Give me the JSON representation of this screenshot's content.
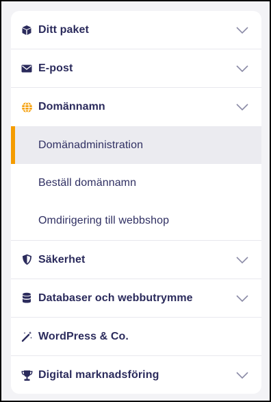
{
  "menu": {
    "accent_color": "#f59c00",
    "text_color": "#2b2b5c",
    "items": [
      {
        "label": "Ditt paket",
        "icon": "box-icon",
        "has_chevron": true
      },
      {
        "label": "E-post",
        "icon": "envelope-icon",
        "has_chevron": true
      },
      {
        "label": "Domännamn",
        "icon": "globe-icon",
        "has_chevron": true,
        "expanded": true,
        "subitems": [
          {
            "label": "Domänadministration",
            "active": true
          },
          {
            "label": "Beställ domännamn",
            "active": false
          },
          {
            "label": "Omdirigering till webbshop",
            "active": false
          }
        ]
      },
      {
        "label": "Säkerhet",
        "icon": "shield-icon",
        "has_chevron": true
      },
      {
        "label": "Databaser och webbutrymme",
        "icon": "database-icon",
        "has_chevron": true
      },
      {
        "label": "WordPress & Co.",
        "icon": "magic-wand-icon",
        "has_chevron": false
      },
      {
        "label": "Digital marknadsföring",
        "icon": "trophy-icon",
        "has_chevron": true
      }
    ]
  }
}
